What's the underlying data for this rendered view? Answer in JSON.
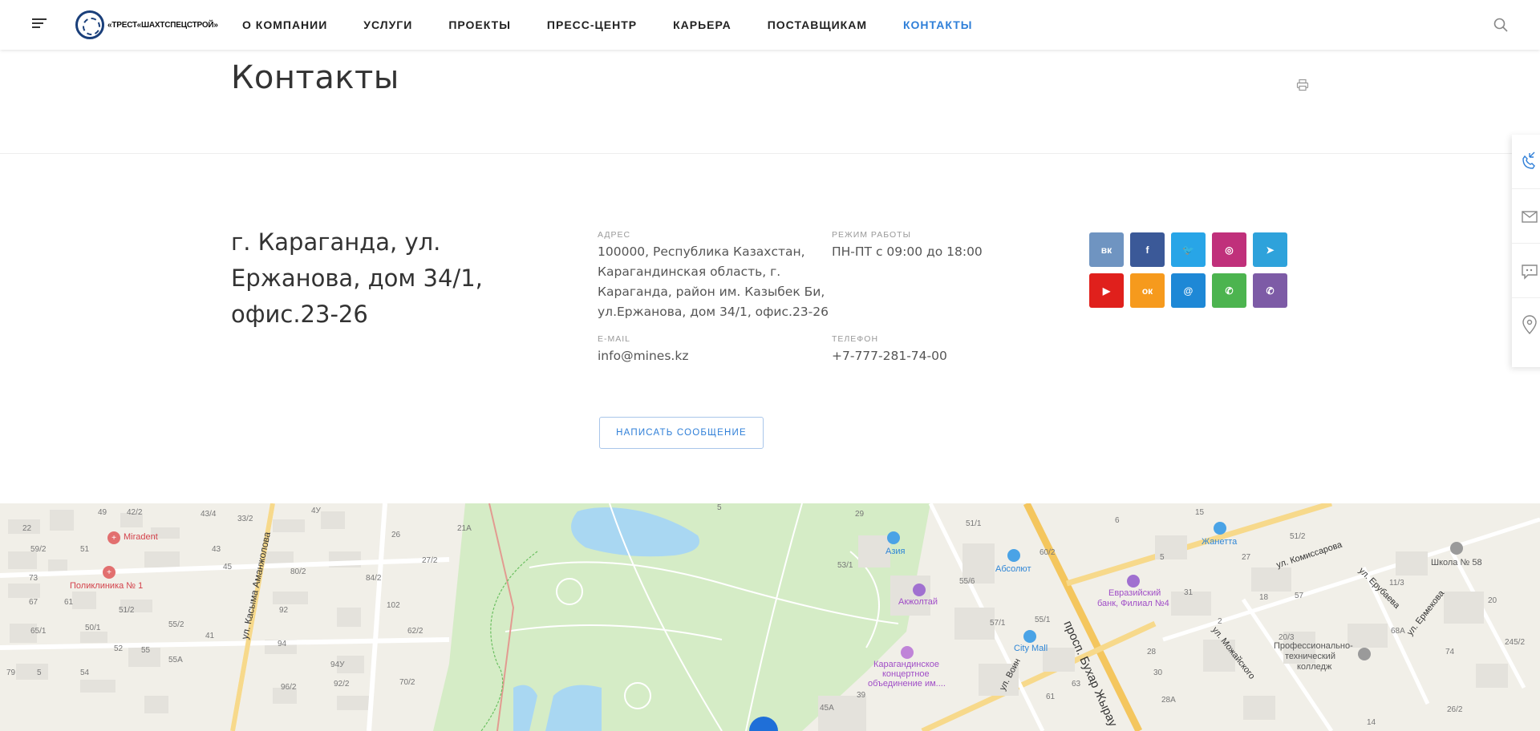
{
  "header": {
    "logo_text": "«ТРЕСТ«ШАХТСПЕЦСТРОЙ»",
    "nav": [
      "О КОМПАНИИ",
      "УСЛУГИ",
      "ПРОЕКТЫ",
      "ПРЕСС-ЦЕНТР",
      "КАРЬЕРА",
      "ПОСТАВЩИКАМ",
      "КОНТАКТЫ"
    ],
    "active_nav": "КОНТАКТЫ",
    "accent_color": "#2f7fd8"
  },
  "page": {
    "title": "Контакты"
  },
  "contacts": {
    "big_address": "г. Караганда, ул. Ержанова, дом 34/1, офис.23-26",
    "address_label": "АДРЕС",
    "address_value": "100000, Республика Казахстан, Карагандинская область, г. Караганда, район им. Казыбек Би, ул.Ержанова, дом 34/1, офис.23-26",
    "hours_label": "РЕЖИМ РАБОТЫ",
    "hours_value": "ПН-ПТ с 09:00 до 18:00",
    "email_label": "E-MAIL",
    "email_value": "info@mines.kz",
    "phone_label": "ТЕЛЕФОН",
    "phone_value": "+7-777-281-74-00",
    "write_button": "НАПИСАТЬ СООБЩЕНИЕ"
  },
  "socials": [
    {
      "name": "vk",
      "glyph": "вк",
      "color": "#6f94c1"
    },
    {
      "name": "facebook",
      "glyph": "f",
      "color": "#3b5998"
    },
    {
      "name": "twitter",
      "glyph": "🐦",
      "color": "#28a5e7"
    },
    {
      "name": "instagram",
      "glyph": "◎",
      "color": "#c0307b"
    },
    {
      "name": "telegram",
      "glyph": "➤",
      "color": "#2ea2db"
    },
    {
      "name": "youtube",
      "glyph": "▶",
      "color": "#e0201c"
    },
    {
      "name": "odnoklassniki",
      "glyph": "ок",
      "color": "#f69a1d"
    },
    {
      "name": "mailru",
      "glyph": "@",
      "color": "#1e88d6"
    },
    {
      "name": "whatsapp",
      "glyph": "✆",
      "color": "#4cb44f"
    },
    {
      "name": "viber",
      "glyph": "✆",
      "color": "#7d5ba6"
    }
  ],
  "map": {
    "labels": [
      {
        "text": "Miradent",
        "cls": "red"
      },
      {
        "text": "Поликлиника № 1",
        "cls": "red"
      },
      {
        "text": "Азия",
        "cls": "blue"
      },
      {
        "text": "Абсолют",
        "cls": "blue"
      },
      {
        "text": "Жанетта",
        "cls": "blue"
      },
      {
        "text": "Евразийский",
        "cls": "purple"
      },
      {
        "text": "банк, Филиал №4",
        "cls": "purple"
      },
      {
        "text": "Акжолтай",
        "cls": "purple"
      },
      {
        "text": "City Mall",
        "cls": "blue"
      },
      {
        "text": "Карагандинское",
        "cls": "purple"
      },
      {
        "text": "концертное",
        "cls": "purple"
      },
      {
        "text": "объединение им....",
        "cls": "purple"
      },
      {
        "text": "Школа № 58",
        "cls": "dark"
      },
      {
        "text": "Профессионально-",
        "cls": "dark"
      },
      {
        "text": "технический",
        "cls": "dark"
      },
      {
        "text": "колледж",
        "cls": "dark"
      }
    ],
    "streets": [
      "ул. Касыма Аманжолова",
      "просп. Бухар Жырау",
      "ул. Комиссарова",
      "ул. Ерубаева",
      "ул. Можайского",
      "ул. Ермекова",
      "ул. Воин"
    ],
    "numbers": [
      "49",
      "42/2",
      "43/4",
      "33/2",
      "4У",
      "22",
      "26",
      "21А",
      "59/2",
      "51",
      "43",
      "27/2",
      "73",
      "45",
      "80/2",
      "84/2",
      "67",
      "61",
      "51/2",
      "102",
      "92",
      "62/2",
      "65/1",
      "50/1",
      "55/2",
      "41",
      "94",
      "79",
      "5",
      "52",
      "55",
      "55А",
      "54",
      "94У",
      "92/2",
      "96/2",
      "70/2",
      "29",
      "51/1",
      "53/1",
      "55/6",
      "60/2",
      "57/1",
      "55/1",
      "6",
      "5",
      "15",
      "51/2",
      "27",
      "31",
      "18",
      "57",
      "11/3",
      "20",
      "68А",
      "2",
      "20/3",
      "74",
      "245/2",
      "28",
      "30",
      "61",
      "63",
      "28А",
      "26/2",
      "14",
      "45А",
      "39",
      "5"
    ]
  }
}
